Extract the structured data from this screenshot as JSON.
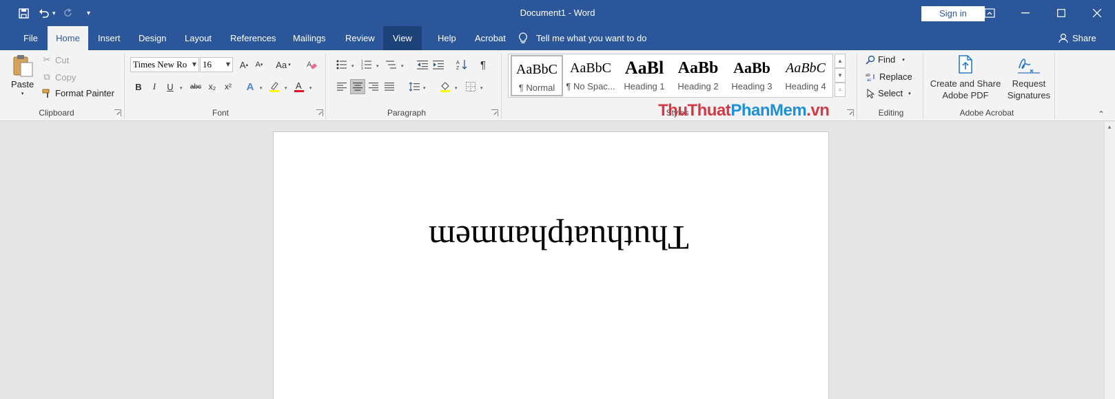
{
  "window": {
    "title": "Document1  -  Word",
    "sign_in": "Sign in"
  },
  "tabs": [
    "File",
    "Home",
    "Insert",
    "Design",
    "Layout",
    "References",
    "Mailings",
    "Review",
    "View",
    "Help",
    "Acrobat"
  ],
  "active_tab": "Home",
  "tell_me": "Tell me what you want to do",
  "share": "Share",
  "clipboard": {
    "paste": "Paste",
    "cut": "Cut",
    "copy": "Copy",
    "format_painter": "Format Painter",
    "label": "Clipboard"
  },
  "font": {
    "name": "Times New Ro",
    "size": "16",
    "label": "Font",
    "bold": "B",
    "italic": "I",
    "underline": "U",
    "strikethrough": "abc",
    "subscript": "x₂",
    "superscript": "x²",
    "grow": "A",
    "shrink": "A",
    "change_case": "Aa",
    "text_effects": "A",
    "font_color": "A"
  },
  "paragraph": {
    "label": "Paragraph",
    "show_marks": "¶"
  },
  "styles": {
    "label": "Styles",
    "items": [
      {
        "preview": "AaBbC",
        "name": "¶ Normal"
      },
      {
        "preview": "AaBbC",
        "name": "¶ No Spac..."
      },
      {
        "preview": "AaBl",
        "name": "Heading 1"
      },
      {
        "preview": "AaBb",
        "name": "Heading 2"
      },
      {
        "preview": "AaBb",
        "name": "Heading 3"
      },
      {
        "preview": "AaBbC",
        "name": "Heading 4"
      }
    ]
  },
  "editing": {
    "find": "Find",
    "replace": "Replace",
    "select": "Select",
    "label": "Editing"
  },
  "acrobat": {
    "create_line1": "Create and Share",
    "create_line2": "Adobe PDF",
    "request_line1": "Request",
    "request_line2": "Signatures",
    "label": "Adobe Acrobat"
  },
  "watermark": {
    "part1": "ThuThuat",
    "part2": "PhanMem",
    "part3": ".vn"
  },
  "document": {
    "text": "Thuthuatphanmem"
  },
  "colors": {
    "title_bar": "#2b579a",
    "ribbon": "#f3f3f3",
    "highlight": "#ffff00",
    "font_color": "#e81123"
  }
}
